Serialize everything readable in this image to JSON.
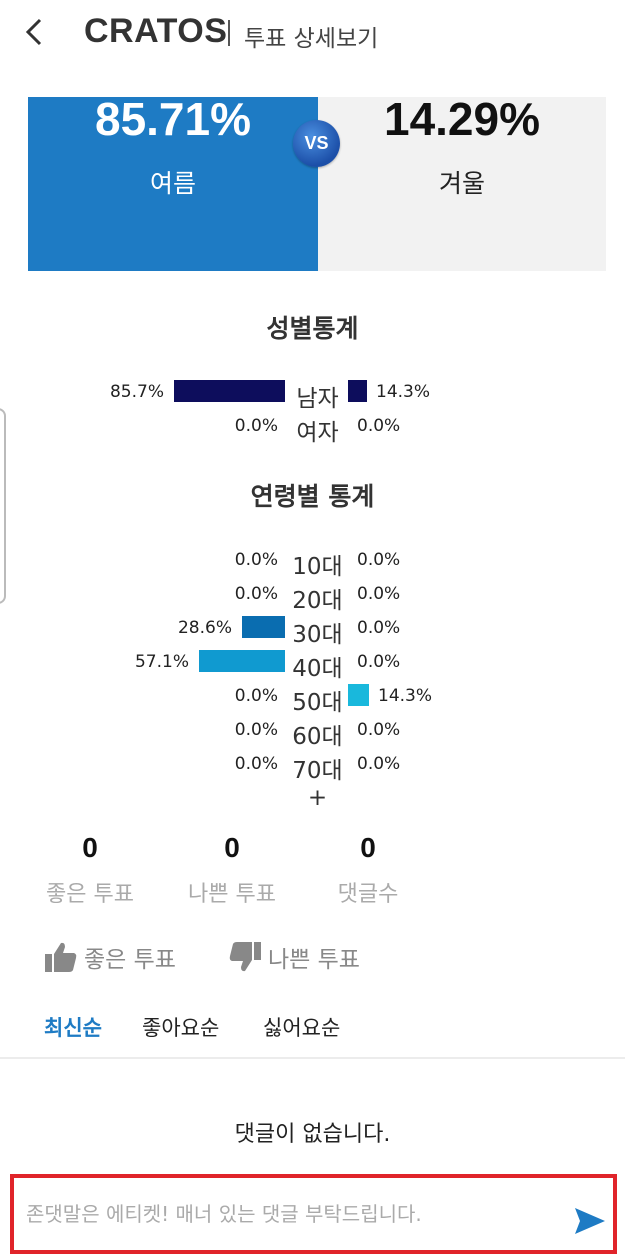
{
  "header": {
    "brand": "CRATOS",
    "subtitle": "투표 상세보기"
  },
  "vote": {
    "left": {
      "percent": "85.71%",
      "label": "여름",
      "color": "#1e7bc4"
    },
    "right": {
      "percent": "14.29%",
      "label": "겨울"
    },
    "vs_label": "VS"
  },
  "gender_stats": {
    "title": "성별통계",
    "rows": [
      {
        "category": "남자",
        "left_value": "85.7%",
        "right_value": "14.3%",
        "left_fraction": 0.857,
        "right_fraction": 0.143,
        "color": "#0d0d5c"
      },
      {
        "category": "여자",
        "left_value": "0.0%",
        "right_value": "0.0%",
        "left_fraction": 0,
        "right_fraction": 0,
        "color": "#0d0d5c"
      }
    ]
  },
  "age_stats": {
    "title": "연령별 통계",
    "rows": [
      {
        "category": "10대",
        "left_value": "0.0%",
        "right_value": "0.0%",
        "left_fraction": 0,
        "right_fraction": 0,
        "color": "#0a6db0"
      },
      {
        "category": "20대",
        "left_value": "0.0%",
        "right_value": "0.0%",
        "left_fraction": 0,
        "right_fraction": 0,
        "color": "#0a6db0"
      },
      {
        "category": "30대",
        "left_value": "28.6%",
        "right_value": "0.0%",
        "left_fraction": 0.286,
        "right_fraction": 0,
        "color": "#0a6db0"
      },
      {
        "category": "40대",
        "left_value": "57.1%",
        "right_value": "0.0%",
        "left_fraction": 0.571,
        "right_fraction": 0,
        "color": "#109ad0"
      },
      {
        "category": "50대",
        "left_value": "0.0%",
        "right_value": "14.3%",
        "left_fraction": 0,
        "right_fraction": 0.143,
        "color": "#19b8dc"
      },
      {
        "category": "60대",
        "left_value": "0.0%",
        "right_value": "0.0%",
        "left_fraction": 0,
        "right_fraction": 0,
        "color": "#19b8dc"
      },
      {
        "category": "70대+",
        "left_value": "0.0%",
        "right_value": "0.0%",
        "left_fraction": 0,
        "right_fraction": 0,
        "color": "#19b8dc"
      }
    ]
  },
  "counts": [
    {
      "value": "0",
      "label": "좋은 투표"
    },
    {
      "value": "0",
      "label": "나쁜 투표"
    },
    {
      "value": "0",
      "label": "댓글수"
    }
  ],
  "actions": {
    "like_label": "좋은 투표",
    "dislike_label": "나쁜 투표",
    "like_icon": "thumbs-up-icon",
    "dislike_icon": "thumbs-down-icon"
  },
  "sort_tabs": [
    {
      "label": "최신순",
      "active": true
    },
    {
      "label": "좋아요순",
      "active": false
    },
    {
      "label": "싫어요순",
      "active": false
    }
  ],
  "comments": {
    "empty_message": "댓글이 없습니다.",
    "input_value": "",
    "placeholder": "존댓말은 에티켓! 매너 있는 댓글 부탁드립니다."
  },
  "colors": {
    "accent": "#1e7bc4",
    "highlight_border": "#e0242a"
  }
}
